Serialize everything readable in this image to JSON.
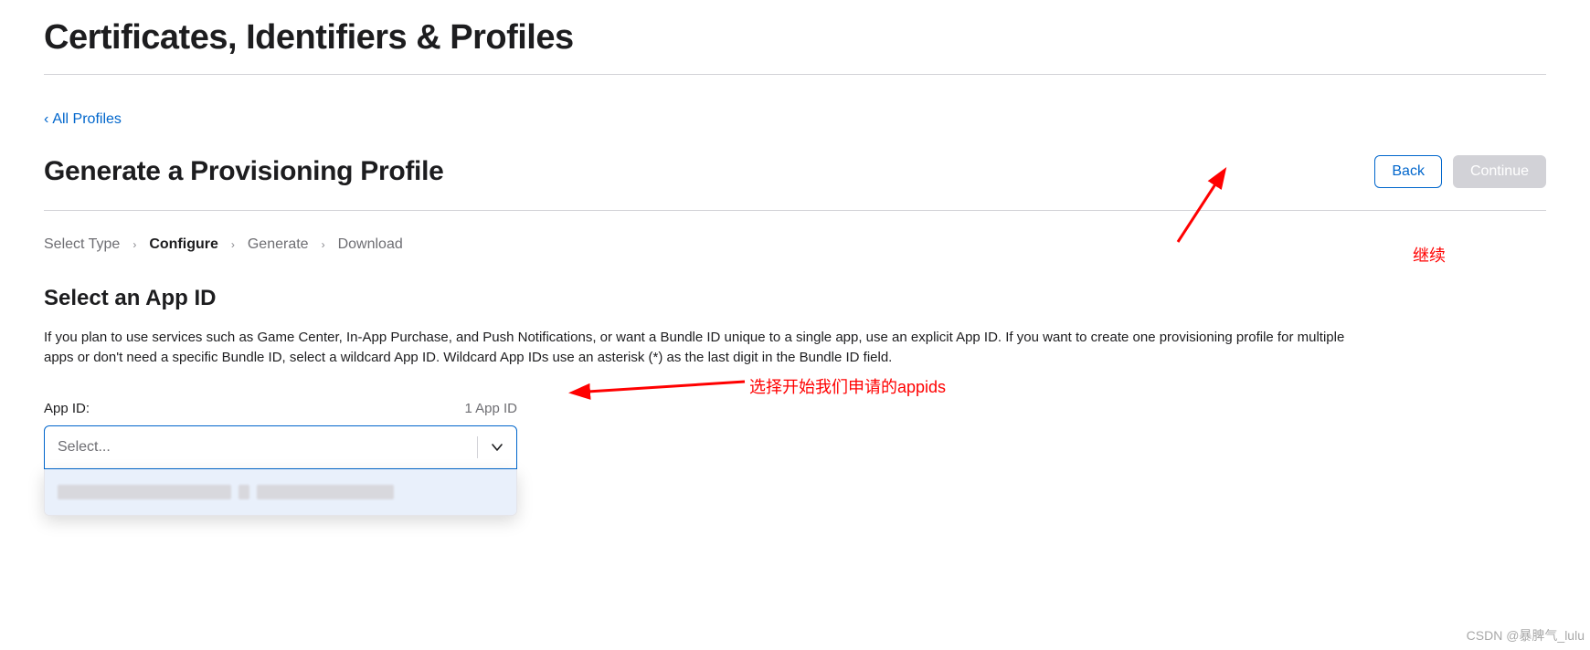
{
  "header": {
    "title": "Certificates, Identifiers & Profiles"
  },
  "back_link": {
    "label": "All Profiles"
  },
  "page": {
    "title": "Generate a Provisioning Profile"
  },
  "buttons": {
    "back": "Back",
    "continue": "Continue"
  },
  "steps": {
    "s0": "Select Type",
    "s1": "Configure",
    "s2": "Generate",
    "s3": "Download"
  },
  "section": {
    "title": "Select an App ID",
    "description": "If you plan to use services such as Game Center, In-App Purchase, and Push Notifications, or want a Bundle ID unique to a single app, use an explicit App ID. If you want to create one provisioning profile for multiple apps or don't need a specific Bundle ID, select a wildcard App ID. Wildcard App IDs use an asterisk (*) as the last digit in the Bundle ID field."
  },
  "appid": {
    "label": "App ID:",
    "count": "1 App ID",
    "placeholder": "Select...",
    "option_redacted": ""
  },
  "annotations": {
    "continue_note": "继续",
    "select_note": "选择开始我们申请的appids"
  },
  "watermark": "CSDN @暴脾气_lulu"
}
